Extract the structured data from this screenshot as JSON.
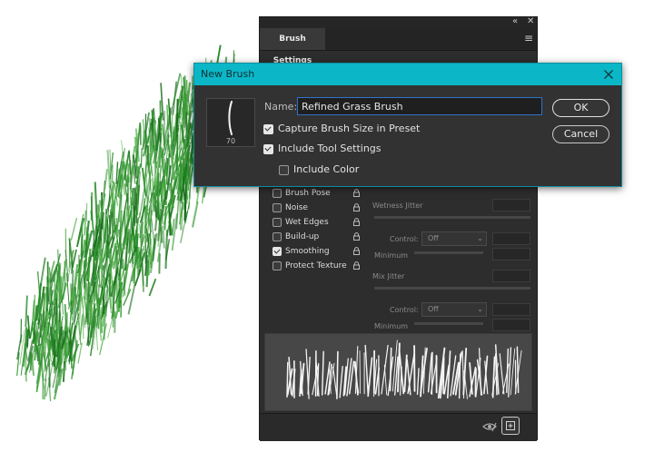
{
  "panel": {
    "tab_label": "Brush Settings",
    "options": [
      {
        "label": "Brush Pose",
        "checked": false
      },
      {
        "label": "Noise",
        "checked": false
      },
      {
        "label": "Wet Edges",
        "checked": false
      },
      {
        "label": "Build-up",
        "checked": false
      },
      {
        "label": "Smoothing",
        "checked": true
      },
      {
        "label": "Protect Texture",
        "checked": false
      }
    ],
    "params": {
      "wetness_jitter": "Wetness Jitter",
      "control_1": "Control:",
      "control_1_value": "Off",
      "minimum_1": "Minimum",
      "mix_jitter": "Mix Jitter",
      "control_2": "Control:",
      "control_2_value": "Off",
      "minimum_2": "Minimum"
    }
  },
  "dialog": {
    "title": "New Brush",
    "name_label": "Name:",
    "name_value": "Refined Grass Brush",
    "thumbnail_size": "70",
    "capture_size": {
      "label": "Capture Brush Size in Preset",
      "checked": true
    },
    "include_tool": {
      "label": "Include Tool Settings",
      "checked": true
    },
    "include_color": {
      "label": "Include Color",
      "checked": false
    },
    "ok_label": "OK",
    "cancel_label": "Cancel"
  },
  "colors": {
    "dialog_titlebar": "#0bb7c7",
    "panel_bg": "#2d2d2d",
    "grass": "#2a8a2a"
  }
}
